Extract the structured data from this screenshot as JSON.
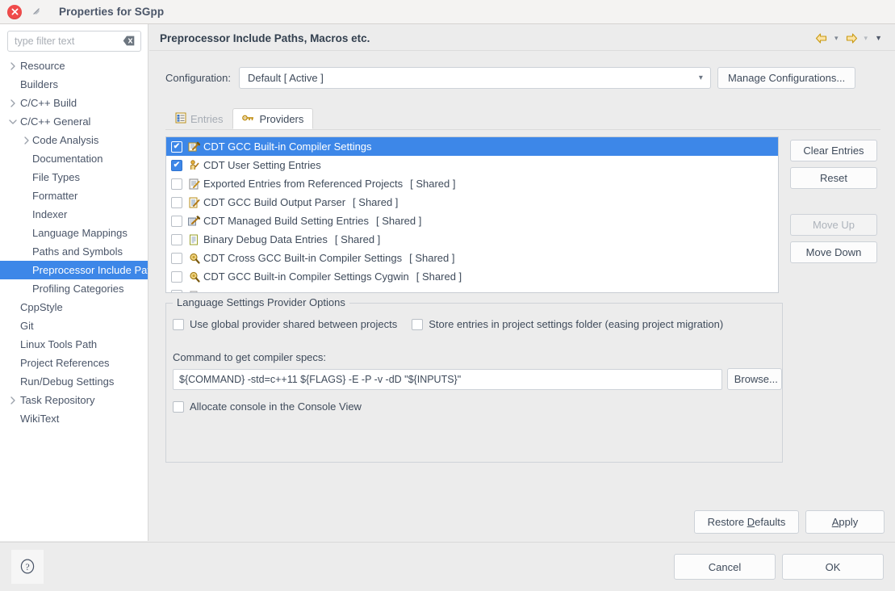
{
  "window": {
    "title": "Properties for SGpp",
    "close_icon": "close-icon",
    "restore_icon": "restore-window-icon"
  },
  "sidebar": {
    "filter": {
      "value": "",
      "placeholder": "type filter text",
      "clear_icon": "clear-text-icon"
    },
    "items": [
      {
        "label": "Resource",
        "level": 0,
        "twisty": "collapsed",
        "selected": false
      },
      {
        "label": "Builders",
        "level": 0,
        "twisty": "none",
        "selected": false
      },
      {
        "label": "C/C++ Build",
        "level": 0,
        "twisty": "collapsed",
        "selected": false
      },
      {
        "label": "C/C++ General",
        "level": 0,
        "twisty": "expanded",
        "selected": false
      },
      {
        "label": "Code Analysis",
        "level": 1,
        "twisty": "collapsed",
        "selected": false
      },
      {
        "label": "Documentation",
        "level": 1,
        "twisty": "none",
        "selected": false
      },
      {
        "label": "File Types",
        "level": 1,
        "twisty": "none",
        "selected": false
      },
      {
        "label": "Formatter",
        "level": 1,
        "twisty": "none",
        "selected": false
      },
      {
        "label": "Indexer",
        "level": 1,
        "twisty": "none",
        "selected": false
      },
      {
        "label": "Language Mappings",
        "level": 1,
        "twisty": "none",
        "selected": false
      },
      {
        "label": "Paths and Symbols",
        "level": 1,
        "twisty": "none",
        "selected": false
      },
      {
        "label": "Preprocessor Include Paths, Macros etc.",
        "level": 1,
        "twisty": "none",
        "selected": true
      },
      {
        "label": "Profiling Categories",
        "level": 1,
        "twisty": "none",
        "selected": false
      },
      {
        "label": "CppStyle",
        "level": 0,
        "twisty": "none",
        "selected": false
      },
      {
        "label": "Git",
        "level": 0,
        "twisty": "none",
        "selected": false
      },
      {
        "label": "Linux Tools Path",
        "level": 0,
        "twisty": "none",
        "selected": false
      },
      {
        "label": "Project References",
        "level": 0,
        "twisty": "none",
        "selected": false
      },
      {
        "label": "Run/Debug Settings",
        "level": 0,
        "twisty": "none",
        "selected": false
      },
      {
        "label": "Task Repository",
        "level": 0,
        "twisty": "collapsed",
        "selected": false
      },
      {
        "label": "WikiText",
        "level": 0,
        "twisty": "none",
        "selected": false
      }
    ]
  },
  "header": {
    "title": "Preprocessor Include Paths, Macros etc.",
    "back_icon": "back-arrow-icon",
    "back_menu_icon": "chevron-down-icon",
    "forward_icon": "forward-arrow-icon",
    "forward_menu_icon": "chevron-down-icon",
    "view_menu_icon": "view-menu-caret-icon"
  },
  "configuration": {
    "label": "Configuration:",
    "value": "Default  [ Active ]",
    "dropdown_icon": "chevron-down-icon",
    "manage_label": "Manage Configurations..."
  },
  "tabs": [
    {
      "label": "Entries",
      "icon": "entries-table-icon",
      "active": false
    },
    {
      "label": "Providers",
      "icon": "providers-key-icon",
      "active": true
    }
  ],
  "providers": {
    "rows": [
      {
        "label": "CDT GCC Built-in Compiler Settings",
        "shared": "",
        "checked": true,
        "selected": true,
        "icon": "compiler-settings-icon"
      },
      {
        "label": "CDT User Setting Entries",
        "shared": "",
        "checked": true,
        "selected": false,
        "icon": "user-entries-icon"
      },
      {
        "label": "Exported Entries from Referenced Projects",
        "shared": "[ Shared ]",
        "checked": false,
        "selected": false,
        "icon": "exported-entries-icon"
      },
      {
        "label": "CDT GCC Build Output Parser",
        "shared": "[ Shared ]",
        "checked": false,
        "selected": false,
        "icon": "build-output-parser-icon"
      },
      {
        "label": "CDT Managed Build Setting Entries",
        "shared": "[ Shared ]",
        "checked": false,
        "selected": false,
        "icon": "managed-build-icon"
      },
      {
        "label": "Binary Debug Data Entries",
        "shared": "[ Shared ]",
        "checked": false,
        "selected": false,
        "icon": "binary-debug-icon"
      },
      {
        "label": "CDT Cross GCC Built-in Compiler Settings",
        "shared": "[ Shared ]",
        "checked": false,
        "selected": false,
        "icon": "cross-gcc-icon"
      },
      {
        "label": "CDT GCC Built-in Compiler Settings Cygwin",
        "shared": "[ Shared ]",
        "checked": false,
        "selected": false,
        "icon": "cygwin-gcc-icon"
      },
      {
        "label": "",
        "shared": "",
        "checked": false,
        "selected": false,
        "icon": "provider-icon"
      }
    ],
    "buttons": {
      "clear_entries": "Clear Entries",
      "reset": "Reset",
      "move_up": "Move Up",
      "move_down": "Move Down"
    }
  },
  "options": {
    "legend": "Language Settings Provider Options",
    "use_global": {
      "label": "Use global provider shared between projects",
      "checked": false
    },
    "store_entries": {
      "label": "Store entries in project settings folder (easing project migration)",
      "checked": false
    },
    "command_label": "Command to get compiler specs:",
    "command_value": "${COMMAND} -std=c++11 ${FLAGS} -E -P -v -dD \"${INPUTS}\"",
    "browse_label": "Browse...",
    "allocate_console": {
      "label": "Allocate console in the Console View",
      "checked": false
    }
  },
  "main_actions": {
    "restore_defaults_pre": "Restore ",
    "restore_defaults_mnemonic": "D",
    "restore_defaults_post": "efaults",
    "apply_mnemonic": "A",
    "apply_post": "pply"
  },
  "footer": {
    "help_icon": "help-question-icon",
    "cancel": "Cancel",
    "ok": "OK"
  },
  "colors": {
    "selection": "#3d87e8",
    "window_bg": "#ececec",
    "panel_bg": "#ffffff",
    "close_red": "#f04a4a",
    "accent_gold": "#e0a91f"
  }
}
